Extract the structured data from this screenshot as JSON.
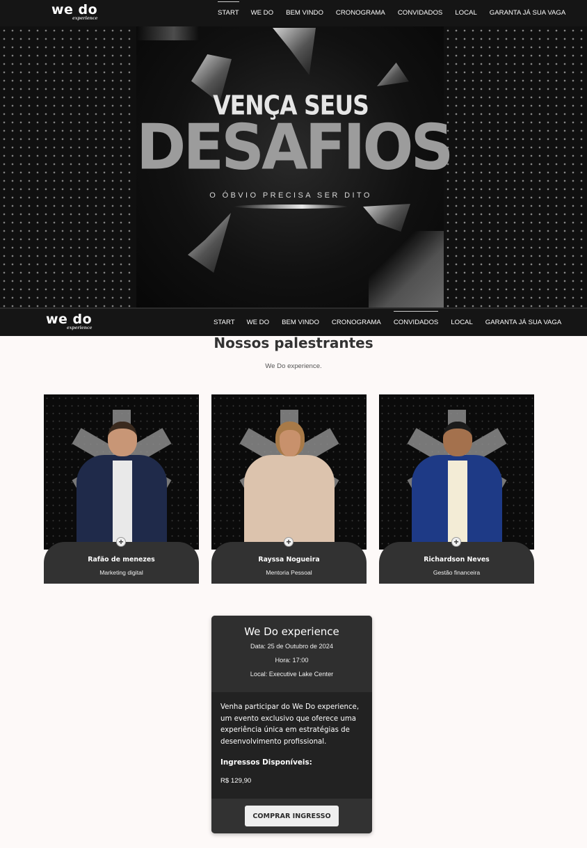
{
  "brand": {
    "logo_main": "we do",
    "logo_sub": "experience"
  },
  "nav": {
    "items": [
      {
        "label": "START"
      },
      {
        "label": "WE DO"
      },
      {
        "label": "BEM VINDO"
      },
      {
        "label": "CRONOGRAMA"
      },
      {
        "label": "CONVIDADOS"
      },
      {
        "label": "LOCAL"
      },
      {
        "label": "GARANTA JÁ SUA VAGA"
      }
    ],
    "top_active": "START",
    "bottom_active": "CONVIDADOS"
  },
  "hero": {
    "line1": "VENÇA SEUS",
    "line2": "DESAFIOS",
    "tagline": "O ÓBVIO PRECISA SER DITO"
  },
  "speakers": {
    "title": "Nossos palestrantes",
    "subtitle": "We Do experience.",
    "items": [
      {
        "name": "Rafão de menezes",
        "role": "Marketing digital",
        "icon": "plus-icon"
      },
      {
        "name": "Rayssa Nogueira",
        "role": "Mentoria Pessoal",
        "icon": "plus-icon"
      },
      {
        "name": "Richardson Neves",
        "role": "Gestão financeira",
        "icon": "plus-icon"
      }
    ]
  },
  "ticket": {
    "title": "We Do experience",
    "date": "Data: 25 de Outubro de 2024",
    "time": "Hora: 17:00",
    "location": "Local: Executive Lake Center",
    "description": "Venha participar do We Do experience, um evento exclusivo que oferece uma experiência única em estratégias de desenvolvimento profissional.",
    "available_label": "Ingressos Disponíveis:",
    "price": "R$ 129,90",
    "button_label": "COMPRAR INGRESSO"
  },
  "colors": {
    "nav_bg": "#151515",
    "page_bg": "#fdf9f8",
    "card_info_bg": "#323232",
    "ticket_bg": "#222222"
  }
}
